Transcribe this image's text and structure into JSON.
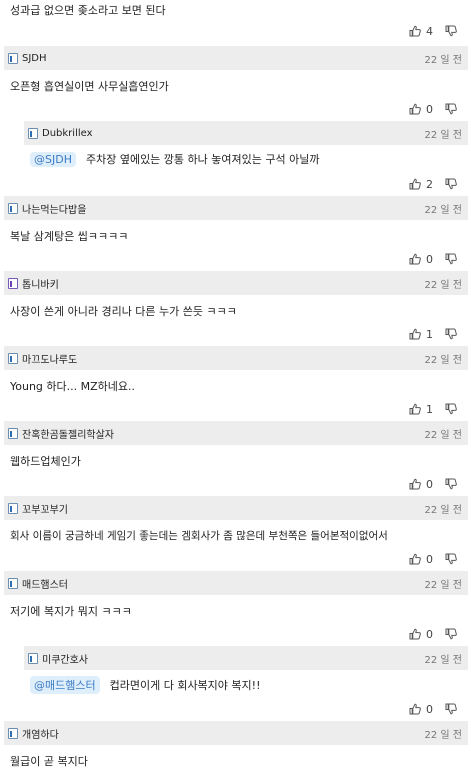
{
  "top_partial": {
    "text": "성과급 없으면 좆소라고 보면 된다",
    "likes": "4"
  },
  "comments": [
    {
      "nick": "SJDH",
      "date": "22 일 전",
      "text": "오픈형 흡연실이면 사무실흡연인가",
      "likes": "0"
    },
    {
      "nick": "Dubkrillex",
      "date": "22 일 전",
      "mention": "@SJDH",
      "text": "주차장 옆에있는 깡통 하나 놓여져있는 구석 아닐까",
      "likes": "2"
    },
    {
      "nick": "나는먹는다밥을",
      "date": "22 일 전",
      "text": "복날 삼계탕은 씹ㅋㅋㅋㅋ",
      "likes": "0"
    },
    {
      "nick": "톱니바키",
      "date": "22 일 전",
      "text": "사장이 쓴게 아니라 경리나 다른 누가 쓴듯 ㅋㅋㅋ",
      "likes": "1"
    },
    {
      "nick": "마끄도나루도",
      "date": "22 일 전",
      "text": "Young 하다... MZ하네요..",
      "likes": "1"
    },
    {
      "nick": "잔혹한곰돌젤리학살자",
      "date": "22 일 전",
      "text": "웹하드업체인가",
      "likes": "0"
    },
    {
      "nick": "꼬부꼬부기",
      "date": "22 일 전",
      "text": "회사 이름이 궁금하네 게임기 좋는데는 겜회사가 좀 많은데 부천쪽은 들어본적이없어서",
      "likes": "0"
    },
    {
      "nick": "매드햄스터",
      "date": "22 일 전",
      "text": "저기에 복지가 뭐지 ㅋㅋㅋ",
      "likes": "0"
    },
    {
      "nick": "미쿠간호사",
      "date": "22 일 전",
      "mention": "@매드햄스터",
      "text": "컵라면이게 다 회사복지야 복지!!",
      "likes": "0"
    },
    {
      "nick": "개염하다",
      "date": "22 일 전",
      "text": "월급이 곧 복지다"
    }
  ]
}
